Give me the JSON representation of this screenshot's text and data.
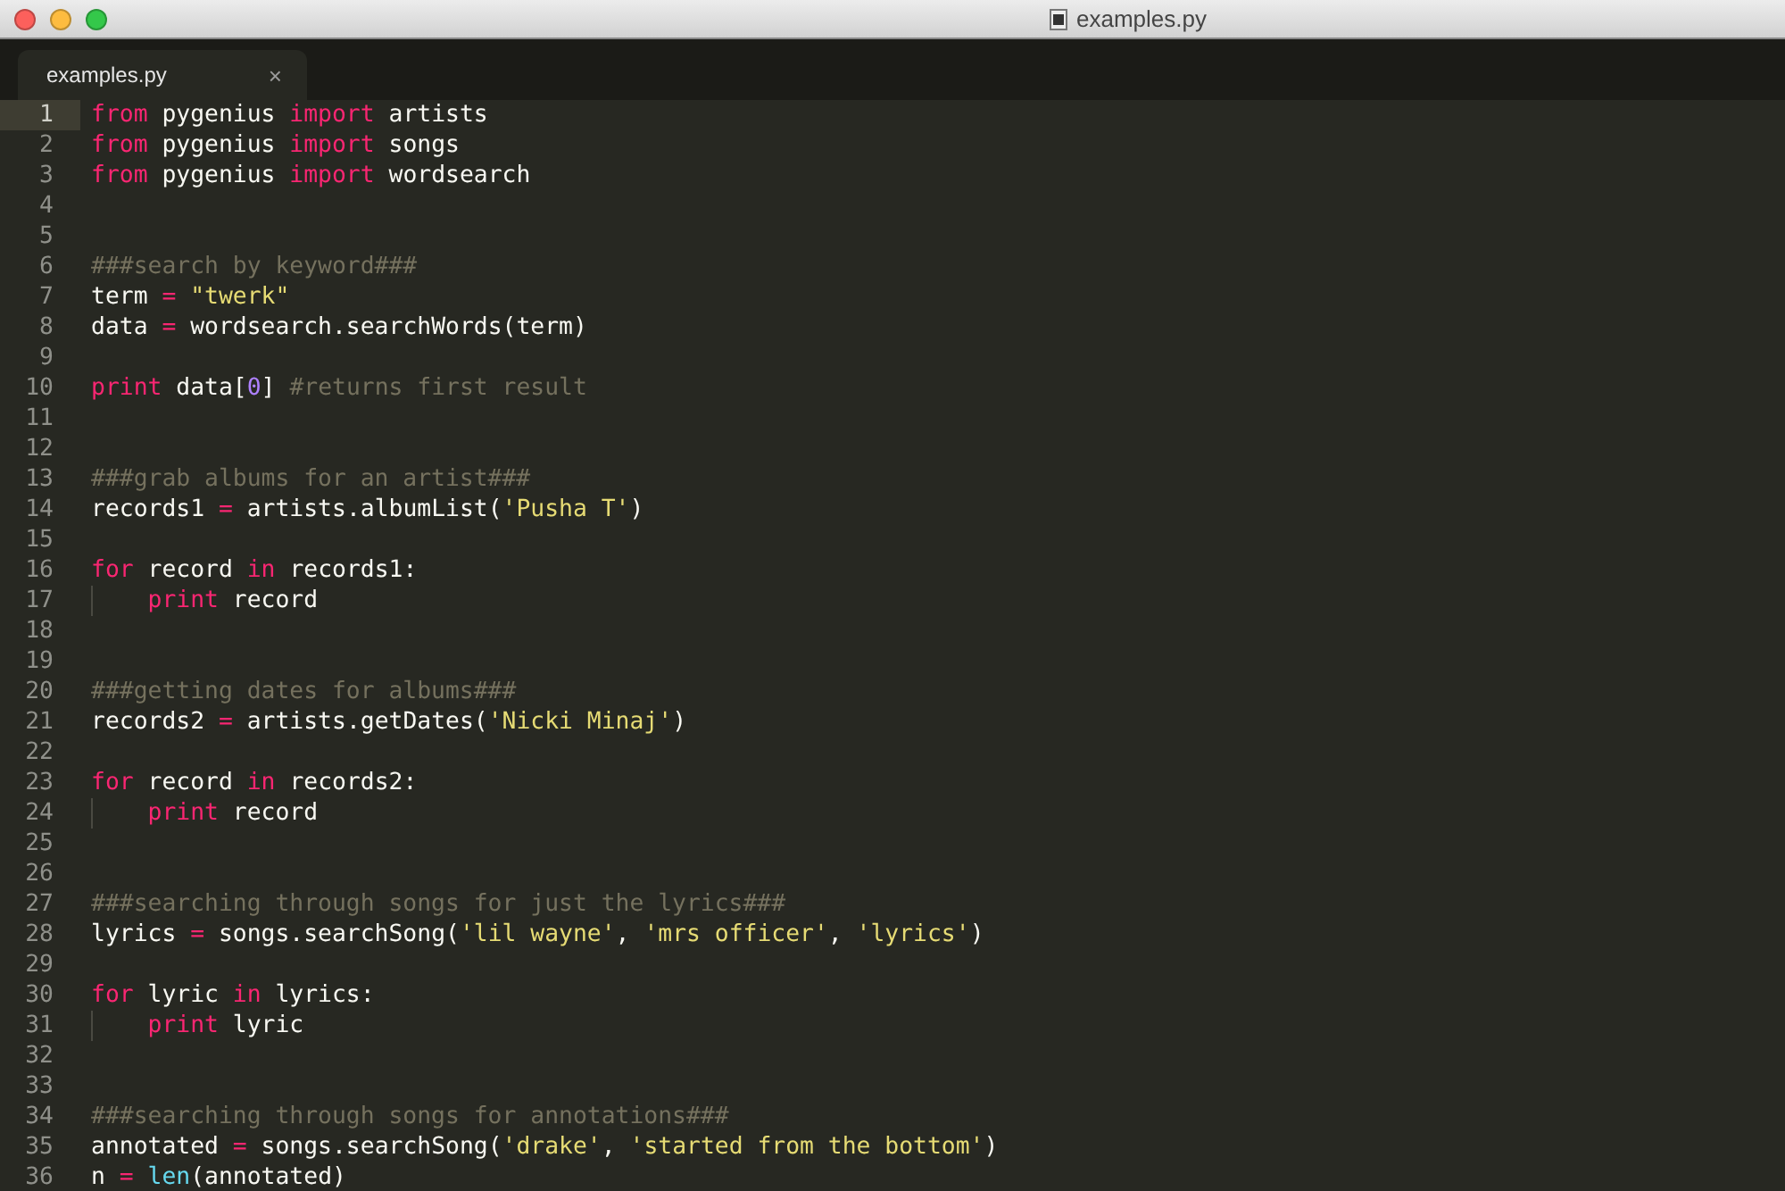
{
  "window": {
    "title": "examples.py"
  },
  "tabs": [
    {
      "label": "examples.py",
      "close": "×",
      "selected": true
    }
  ],
  "editor": {
    "lines": [
      {
        "number": "1",
        "current": true,
        "tokens": [
          {
            "kind": "keyword",
            "text": "from"
          },
          {
            "kind": "plain",
            "text": " pygenius "
          },
          {
            "kind": "keyword",
            "text": "import"
          },
          {
            "kind": "plain",
            "text": " artists"
          }
        ]
      },
      {
        "number": "2",
        "current": false,
        "tokens": [
          {
            "kind": "keyword",
            "text": "from"
          },
          {
            "kind": "plain",
            "text": " pygenius "
          },
          {
            "kind": "keyword",
            "text": "import"
          },
          {
            "kind": "plain",
            "text": " songs"
          }
        ]
      },
      {
        "number": "3",
        "current": false,
        "tokens": [
          {
            "kind": "keyword",
            "text": "from"
          },
          {
            "kind": "plain",
            "text": " pygenius "
          },
          {
            "kind": "keyword",
            "text": "import"
          },
          {
            "kind": "plain",
            "text": " wordsearch"
          }
        ]
      },
      {
        "number": "4",
        "current": false
      },
      {
        "number": "5",
        "current": false
      },
      {
        "number": "6",
        "current": false,
        "tokens": [
          {
            "kind": "comment",
            "text": "###search by keyword###"
          }
        ]
      },
      {
        "number": "7",
        "current": false,
        "tokens": [
          {
            "kind": "plain",
            "text": "term "
          },
          {
            "kind": "operator",
            "text": "= "
          },
          {
            "kind": "string",
            "text": "\"twerk\""
          }
        ]
      },
      {
        "number": "8",
        "current": false,
        "tokens": [
          {
            "kind": "plain",
            "text": "data "
          },
          {
            "kind": "operator",
            "text": "="
          },
          {
            "kind": "plain",
            "text": " wordsearch.searchWords(term)"
          }
        ]
      },
      {
        "number": "9",
        "current": false
      },
      {
        "number": "10",
        "current": false,
        "tokens": [
          {
            "kind": "keyword",
            "text": "print"
          },
          {
            "kind": "plain",
            "text": " data["
          },
          {
            "kind": "number",
            "text": "0"
          },
          {
            "kind": "plain",
            "text": "] "
          },
          {
            "kind": "comment",
            "text": "#returns first result"
          }
        ]
      },
      {
        "number": "11",
        "current": false
      },
      {
        "number": "12",
        "current": false
      },
      {
        "number": "13",
        "current": false,
        "tokens": [
          {
            "kind": "comment",
            "text": "###grab albums for an artist###"
          }
        ]
      },
      {
        "number": "14",
        "current": false,
        "tokens": [
          {
            "kind": "plain",
            "text": "records1 "
          },
          {
            "kind": "operator",
            "text": "="
          },
          {
            "kind": "plain",
            "text": " artists.albumList("
          },
          {
            "kind": "string",
            "text": "'Pusha T'"
          },
          {
            "kind": "plain",
            "text": ")"
          }
        ]
      },
      {
        "number": "15",
        "current": false
      },
      {
        "number": "16",
        "current": false,
        "tokens": [
          {
            "kind": "keyword",
            "text": "for"
          },
          {
            "kind": "plain",
            "text": " record "
          },
          {
            "kind": "keyword",
            "text": "in"
          },
          {
            "kind": "plain",
            "text": " records1:"
          }
        ]
      },
      {
        "number": "17",
        "current": false,
        "indented": true,
        "tokens": [
          {
            "kind": "keyword",
            "text": "print"
          },
          {
            "kind": "plain",
            "text": " record"
          }
        ]
      },
      {
        "number": "18",
        "current": false
      },
      {
        "number": "19",
        "current": false
      },
      {
        "number": "20",
        "current": false,
        "tokens": [
          {
            "kind": "comment",
            "text": "###getting dates for albums###"
          }
        ]
      },
      {
        "number": "21",
        "current": false,
        "tokens": [
          {
            "kind": "plain",
            "text": "records2 "
          },
          {
            "kind": "operator",
            "text": "="
          },
          {
            "kind": "plain",
            "text": " artists.getDates("
          },
          {
            "kind": "string",
            "text": "'Nicki Minaj'"
          },
          {
            "kind": "plain",
            "text": ")"
          }
        ]
      },
      {
        "number": "22",
        "current": false
      },
      {
        "number": "23",
        "current": false,
        "tokens": [
          {
            "kind": "keyword",
            "text": "for"
          },
          {
            "kind": "plain",
            "text": " record "
          },
          {
            "kind": "keyword",
            "text": "in"
          },
          {
            "kind": "plain",
            "text": " records2:"
          }
        ]
      },
      {
        "number": "24",
        "current": false,
        "indented": true,
        "tokens": [
          {
            "kind": "keyword",
            "text": "print"
          },
          {
            "kind": "plain",
            "text": " record"
          }
        ]
      },
      {
        "number": "25",
        "current": false
      },
      {
        "number": "26",
        "current": false
      },
      {
        "number": "27",
        "current": false,
        "tokens": [
          {
            "kind": "comment",
            "text": "###searching through songs for just the lyrics###"
          }
        ]
      },
      {
        "number": "28",
        "current": false,
        "tokens": [
          {
            "kind": "plain",
            "text": "lyrics "
          },
          {
            "kind": "operator",
            "text": "="
          },
          {
            "kind": "plain",
            "text": " songs.searchSong("
          },
          {
            "kind": "string",
            "text": "'lil wayne'"
          },
          {
            "kind": "plain",
            "text": ", "
          },
          {
            "kind": "string",
            "text": "'mrs officer'"
          },
          {
            "kind": "plain",
            "text": ", "
          },
          {
            "kind": "string",
            "text": "'lyrics'"
          },
          {
            "kind": "plain",
            "text": ")"
          }
        ]
      },
      {
        "number": "29",
        "current": false
      },
      {
        "number": "30",
        "current": false,
        "tokens": [
          {
            "kind": "keyword",
            "text": "for"
          },
          {
            "kind": "plain",
            "text": " lyric "
          },
          {
            "kind": "keyword",
            "text": "in"
          },
          {
            "kind": "plain",
            "text": " lyrics:"
          }
        ]
      },
      {
        "number": "31",
        "current": false,
        "indented": true,
        "tokens": [
          {
            "kind": "keyword",
            "text": "print"
          },
          {
            "kind": "plain",
            "text": " lyric"
          }
        ]
      },
      {
        "number": "32",
        "current": false
      },
      {
        "number": "33",
        "current": false
      },
      {
        "number": "34",
        "current": false,
        "tokens": [
          {
            "kind": "comment",
            "text": "###searching through songs for annotations###"
          }
        ]
      },
      {
        "number": "35",
        "current": false,
        "tokens": [
          {
            "kind": "plain",
            "text": "annotated "
          },
          {
            "kind": "operator",
            "text": "="
          },
          {
            "kind": "plain",
            "text": " songs.searchSong("
          },
          {
            "kind": "string",
            "text": "'drake'"
          },
          {
            "kind": "plain",
            "text": ", "
          },
          {
            "kind": "string",
            "text": "'started from the bottom'"
          },
          {
            "kind": "plain",
            "text": ")"
          }
        ]
      },
      {
        "number": "36",
        "current": false,
        "tokens": [
          {
            "kind": "plain",
            "text": "n "
          },
          {
            "kind": "operator",
            "text": "= "
          },
          {
            "kind": "builtin",
            "text": "len"
          },
          {
            "kind": "plain",
            "text": "(annotated)"
          }
        ]
      }
    ]
  }
}
